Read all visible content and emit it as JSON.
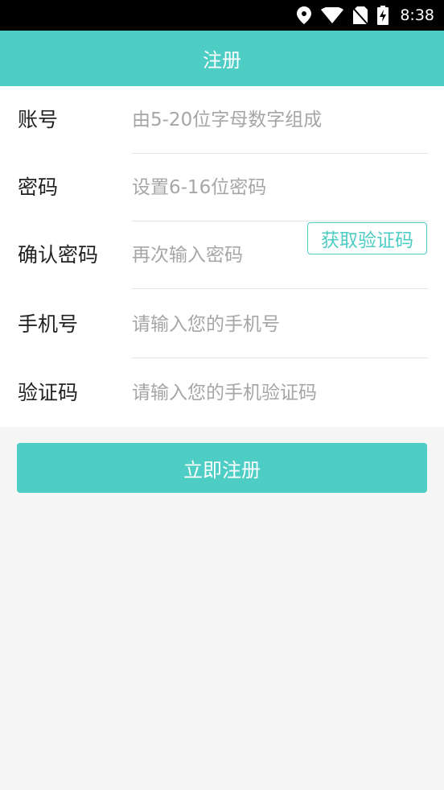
{
  "status_bar": {
    "time": "8:38",
    "icons": [
      "location-icon",
      "wifi-icon",
      "no-sim-icon",
      "battery-charging-icon"
    ]
  },
  "header": {
    "title": "注册"
  },
  "form": {
    "account": {
      "label": "账号",
      "placeholder": "由5-20位字母数字组成"
    },
    "password": {
      "label": "密码",
      "placeholder": "设置6-16位密码"
    },
    "confirm_password": {
      "label": "确认密码",
      "placeholder": "再次输入密码"
    },
    "phone": {
      "label": "手机号",
      "placeholder": "请输入您的手机号",
      "get_code_label": "获取验证码"
    },
    "code": {
      "label": "验证码",
      "placeholder": "请输入您的手机验证码"
    }
  },
  "submit_label": "立即注册",
  "colors": {
    "accent": "#4ecdc4",
    "background": "#f5f5f5"
  }
}
